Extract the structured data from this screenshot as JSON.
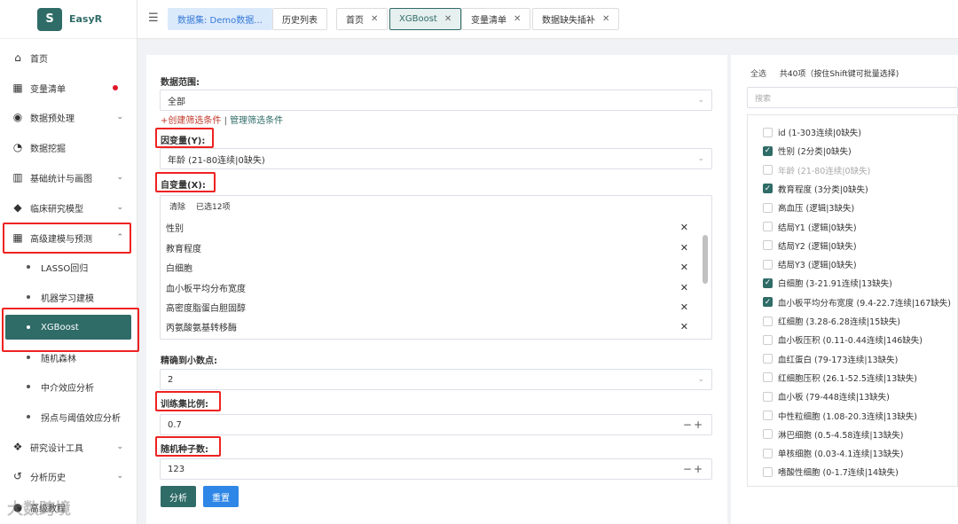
{
  "app": {
    "logo_letter": "S",
    "name": "EasyR"
  },
  "sidebar": {
    "items": [
      {
        "icon": "home-icon",
        "glyph": "⌂",
        "label": "首页"
      },
      {
        "icon": "table-icon",
        "glyph": "▦",
        "label": "变量清单",
        "dot": true
      },
      {
        "icon": "database-icon",
        "glyph": "◉",
        "label": "数据预处理"
      },
      {
        "icon": "mining-icon",
        "glyph": "◔",
        "label": "数据挖掘"
      },
      {
        "icon": "bar-chart-icon",
        "glyph": "▥",
        "label": "基础统计与画图"
      },
      {
        "icon": "cube-icon",
        "glyph": "◆",
        "label": "临床研究模型"
      },
      {
        "icon": "grid-icon",
        "glyph": "▦",
        "label": "高级建模与预测"
      }
    ],
    "sub_items": [
      "LASSO回归",
      "机器学习建模",
      "XGBoost",
      "随机森林",
      "中介效应分析",
      "拐点与阈值效应分析"
    ],
    "bottom_items": [
      {
        "icon": "cubes-icon",
        "glyph": "❖",
        "label": "研究设计工具"
      },
      {
        "icon": "history-icon",
        "glyph": "↺",
        "label": "分析历史"
      },
      {
        "icon": "user-icon",
        "glyph": "●",
        "label": "高级教程"
      }
    ]
  },
  "tabs": {
    "collapse_glyph": "☰",
    "items": [
      {
        "label": "数据集: Demo数据..."
      },
      {
        "label": "历史列表"
      },
      {
        "label": "首页",
        "close": "✕"
      },
      {
        "label": "XGBoost",
        "close": "✕"
      },
      {
        "label": "变量清单",
        "close": "✕"
      },
      {
        "label": "数据缺失插补",
        "close": "✕"
      }
    ]
  },
  "form": {
    "range_label": "数据范围:",
    "range_value": "全部",
    "create_filter": "+创建筛选条件",
    "separator": " | ",
    "manage_filter": "管理筛选条件",
    "dependent_label": "因变量(Y):",
    "dependent_value": "年龄 (21-80连续|0缺失)",
    "independent_label": "自变量(X):",
    "clear_label": "清除",
    "selected_count": "已选12项",
    "selected": [
      "性别",
      "教育程度",
      "白细胞",
      "血小板平均分布宽度",
      "高密度脂蛋白胆固醇",
      "丙氨酸氨基转移酶"
    ],
    "decimal_label": "精确到小数点:",
    "decimal_value": "2",
    "train_ratio_label": "训练集比例:",
    "train_ratio_value": "0.7",
    "seed_label": "随机种子数:",
    "seed_value": "123",
    "stepper_glyph": "−+",
    "analyze_button": "分析",
    "reset_button": "重置"
  },
  "var_panel": {
    "select_all": "全选",
    "summary": "共40项（按住Shift键可批量选择)",
    "search_placeholder": "搜索",
    "items": [
      {
        "label": "id (1-303连续|0缺失)",
        "checked": false
      },
      {
        "label": "性别 (2分类|0缺失)",
        "checked": true
      },
      {
        "label": "年龄 (21-80连续|0缺失)",
        "checked": false,
        "disabled": true
      },
      {
        "label": "教育程度 (3分类|0缺失)",
        "checked": true
      },
      {
        "label": "高血压 (逻辑|3缺失)",
        "checked": false
      },
      {
        "label": "结局Y1 (逻辑|0缺失)",
        "checked": false
      },
      {
        "label": "结局Y2 (逻辑|0缺失)",
        "checked": false
      },
      {
        "label": "结局Y3 (逻辑|0缺失)",
        "checked": false
      },
      {
        "label": "白细胞 (3-21.91连续|13缺失)",
        "checked": true
      },
      {
        "label": "血小板平均分布宽度 (9.4-22.7连续|167缺失)",
        "checked": true
      },
      {
        "label": "红细胞 (3.28-6.28连续|15缺失)",
        "checked": false
      },
      {
        "label": "血小板压积 (0.11-0.44连续|146缺失)",
        "checked": false
      },
      {
        "label": "血红蛋白 (79-173连续|13缺失)",
        "checked": false
      },
      {
        "label": "红细胞压积 (26.1-52.5连续|13缺失)",
        "checked": false
      },
      {
        "label": "血小板 (79-448连续|13缺失)",
        "checked": false
      },
      {
        "label": "中性粒细胞 (1.08-20.3连续|13缺失)",
        "checked": false
      },
      {
        "label": "淋巴细胞 (0.5-4.58连续|13缺失)",
        "checked": false
      },
      {
        "label": "单核细胞 (0.03-4.1连续|13缺失)",
        "checked": false
      },
      {
        "label": "嗜酸性细胞 (0-1.7连续|14缺失)",
        "checked": false
      }
    ]
  },
  "watermark": "大数跨境"
}
